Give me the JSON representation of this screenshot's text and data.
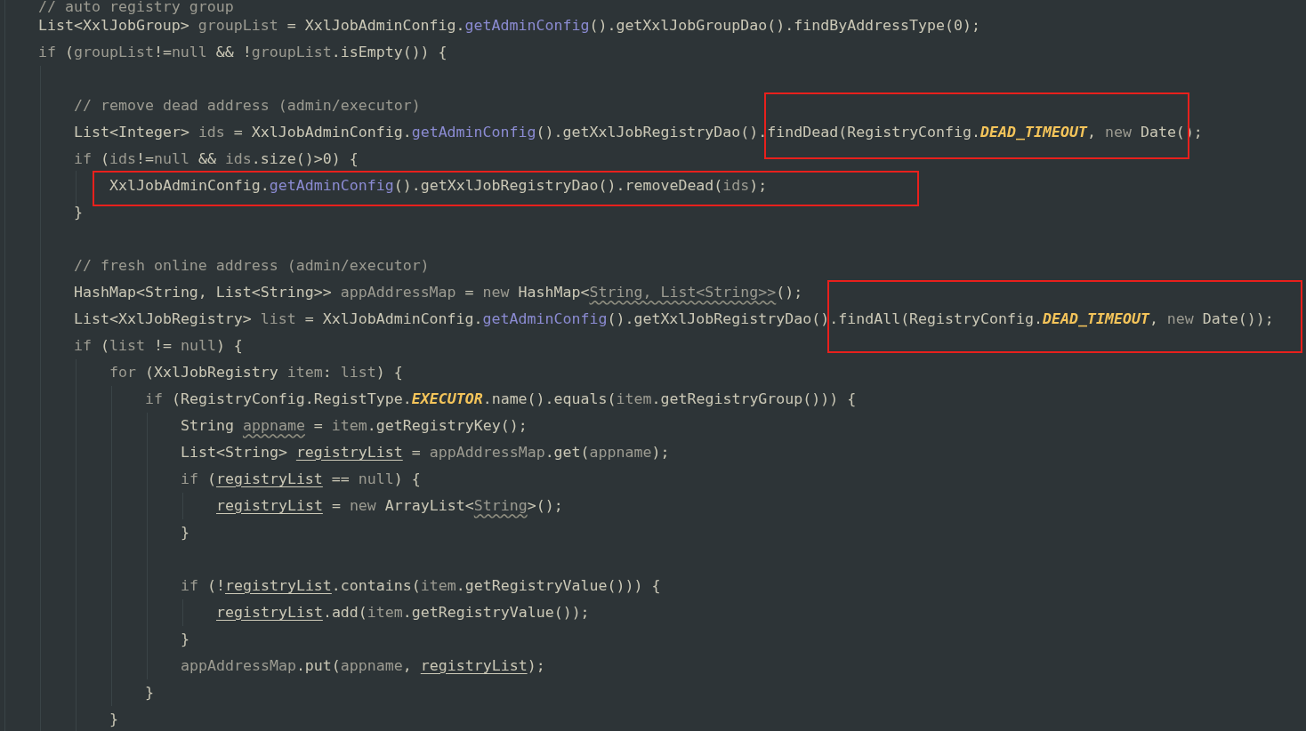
{
  "editor": {
    "lines": [
      {
        "kind": "code",
        "tokens": [
          {
            "text": "// auto registry group",
            "kind": "comment"
          }
        ]
      },
      {
        "kind": "code",
        "tokens": [
          {
            "text": "List<XxlJobGroup> ",
            "kind": "plain"
          },
          {
            "text": "groupList",
            "kind": "local"
          },
          {
            "text": " = XxlJobAdminConfig.",
            "kind": "plain"
          },
          {
            "text": "getAdminConfig",
            "kind": "static"
          },
          {
            "text": "().getXxlJobGroupDao().findByAddressType(0);",
            "kind": "plain"
          }
        ]
      },
      {
        "kind": "code",
        "tokens": [
          {
            "text": "if",
            "kind": "local"
          },
          {
            "text": " (",
            "kind": "plain"
          },
          {
            "text": "groupList",
            "kind": "local"
          },
          {
            "text": "!=",
            "kind": "plain"
          },
          {
            "text": "null",
            "kind": "local"
          },
          {
            "text": " && !",
            "kind": "plain"
          },
          {
            "text": "groupList",
            "kind": "local"
          },
          {
            "text": ".isEmpty()) {",
            "kind": "plain"
          }
        ],
        "children": [
          {
            "kind": "blank"
          },
          {
            "kind": "code",
            "tokens": [
              {
                "text": "// remove dead address (admin/executor)",
                "kind": "comment"
              }
            ]
          },
          {
            "kind": "code",
            "tokens": [
              {
                "text": "List<Integer> ",
                "kind": "plain"
              },
              {
                "text": "ids",
                "kind": "local"
              },
              {
                "text": " = XxlJobAdminConfig.",
                "kind": "plain"
              },
              {
                "text": "getAdminConfig",
                "kind": "static"
              },
              {
                "text": "().getXxlJobRegistryDao().",
                "kind": "plain"
              }
            ],
            "highlight": [
              {
                "text": "findDead(RegistryConfig.",
                "kind": "plain"
              },
              {
                "text": "DEAD_TIMEOUT",
                "kind": "constant"
              },
              {
                "text": ", ",
                "kind": "plain"
              },
              {
                "text": "new",
                "kind": "local"
              },
              {
                "text": " Date(",
                "kind": "plain"
              }
            ],
            "after": [
              {
                "text": ");",
                "kind": "plain"
              }
            ]
          },
          {
            "kind": "code",
            "tokens": [
              {
                "text": "if",
                "kind": "local"
              },
              {
                "text": " (",
                "kind": "plain"
              },
              {
                "text": "ids",
                "kind": "local"
              },
              {
                "text": "!=",
                "kind": "plain"
              },
              {
                "text": "null",
                "kind": "local"
              },
              {
                "text": " && ",
                "kind": "plain"
              },
              {
                "text": "ids",
                "kind": "local"
              },
              {
                "text": ".size()>0) {",
                "kind": "plain"
              }
            ],
            "children": [
              {
                "kind": "code",
                "highlight": [
                  {
                    "text": "XxlJobAdminConfig.",
                    "kind": "plain"
                  },
                  {
                    "text": "getAdminConfig",
                    "kind": "static"
                  },
                  {
                    "text": "().getXxlJobRegistryDao().removeDead(",
                    "kind": "plain"
                  },
                  {
                    "text": "ids",
                    "kind": "local"
                  },
                  {
                    "text": ");",
                    "kind": "plain"
                  }
                ]
              }
            ]
          },
          {
            "kind": "code",
            "tokens": [
              {
                "text": "}",
                "kind": "plain"
              }
            ]
          },
          {
            "kind": "blank"
          },
          {
            "kind": "code",
            "tokens": [
              {
                "text": "// fresh online address (admin/executor)",
                "kind": "comment"
              }
            ]
          },
          {
            "kind": "code",
            "tokens": [
              {
                "text": "HashMap<String, List<String>> ",
                "kind": "plain"
              },
              {
                "text": "appAddressMap",
                "kind": "local"
              },
              {
                "text": " = ",
                "kind": "plain"
              },
              {
                "text": "new",
                "kind": "local"
              },
              {
                "text": " HashMap<",
                "kind": "plain"
              },
              {
                "text": "String, List<String>>",
                "kind": "redundant"
              },
              {
                "text": "();",
                "kind": "plain"
              }
            ]
          },
          {
            "kind": "code",
            "tokens": [
              {
                "text": "List<XxlJobRegistry> ",
                "kind": "plain"
              },
              {
                "text": "list",
                "kind": "local"
              },
              {
                "text": " = XxlJobAdminConfig.",
                "kind": "plain"
              },
              {
                "text": "getAdminConfig",
                "kind": "static"
              },
              {
                "text": "().getXxlJobRegistryDao()",
                "kind": "plain"
              }
            ],
            "highlight": [
              {
                "text": ".findAll(RegistryConfig.",
                "kind": "plain"
              },
              {
                "text": "DEAD_TIMEOUT",
                "kind": "constant"
              },
              {
                "text": ", ",
                "kind": "plain"
              },
              {
                "text": "new",
                "kind": "local"
              },
              {
                "text": " Date());",
                "kind": "plain"
              }
            ]
          },
          {
            "kind": "code",
            "tokens": [
              {
                "text": "if",
                "kind": "local"
              },
              {
                "text": " (",
                "kind": "plain"
              },
              {
                "text": "list",
                "kind": "local"
              },
              {
                "text": " != ",
                "kind": "plain"
              },
              {
                "text": "null",
                "kind": "local"
              },
              {
                "text": ") {",
                "kind": "plain"
              }
            ],
            "children": [
              {
                "kind": "code",
                "tokens": [
                  {
                    "text": "for",
                    "kind": "local"
                  },
                  {
                    "text": " (XxlJobRegistry ",
                    "kind": "plain"
                  },
                  {
                    "text": "item",
                    "kind": "local"
                  },
                  {
                    "text": ": ",
                    "kind": "plain"
                  },
                  {
                    "text": "list",
                    "kind": "local"
                  },
                  {
                    "text": ") {",
                    "kind": "plain"
                  }
                ],
                "children": [
                  {
                    "kind": "code",
                    "tokens": [
                      {
                        "text": "if",
                        "kind": "local"
                      },
                      {
                        "text": " (RegistryConfig.RegistType.",
                        "kind": "plain"
                      },
                      {
                        "text": "EXECUTOR",
                        "kind": "constant"
                      },
                      {
                        "text": ".name().equals(",
                        "kind": "plain"
                      },
                      {
                        "text": "item",
                        "kind": "local"
                      },
                      {
                        "text": ".getRegistryGroup())) {",
                        "kind": "plain"
                      }
                    ],
                    "children": [
                      {
                        "kind": "code",
                        "tokens": [
                          {
                            "text": "String ",
                            "kind": "plain"
                          },
                          {
                            "text": "appname",
                            "kind": "redundant"
                          },
                          {
                            "text": " = ",
                            "kind": "plain"
                          },
                          {
                            "text": "item",
                            "kind": "local"
                          },
                          {
                            "text": ".getRegistryKey();",
                            "kind": "plain"
                          }
                        ]
                      },
                      {
                        "kind": "code",
                        "tokens": [
                          {
                            "text": "List<String> ",
                            "kind": "plain"
                          },
                          {
                            "text": "registryList",
                            "kind": "reassigned"
                          },
                          {
                            "text": " = ",
                            "kind": "plain"
                          },
                          {
                            "text": "appAddressMap",
                            "kind": "local"
                          },
                          {
                            "text": ".get(",
                            "kind": "plain"
                          },
                          {
                            "text": "appname",
                            "kind": "local"
                          },
                          {
                            "text": ");",
                            "kind": "plain"
                          }
                        ]
                      },
                      {
                        "kind": "code",
                        "tokens": [
                          {
                            "text": "if",
                            "kind": "local"
                          },
                          {
                            "text": " (",
                            "kind": "plain"
                          },
                          {
                            "text": "registryList",
                            "kind": "reassigned"
                          },
                          {
                            "text": " == ",
                            "kind": "plain"
                          },
                          {
                            "text": "null",
                            "kind": "local"
                          },
                          {
                            "text": ") {",
                            "kind": "plain"
                          }
                        ],
                        "children": [
                          {
                            "kind": "code",
                            "tokens": [
                              {
                                "text": "registryList",
                                "kind": "reassigned"
                              },
                              {
                                "text": " = ",
                                "kind": "plain"
                              },
                              {
                                "text": "new",
                                "kind": "local"
                              },
                              {
                                "text": " ArrayList<",
                                "kind": "plain"
                              },
                              {
                                "text": "String",
                                "kind": "redundant"
                              },
                              {
                                "text": ">();",
                                "kind": "plain"
                              }
                            ]
                          }
                        ]
                      },
                      {
                        "kind": "code",
                        "tokens": [
                          {
                            "text": "}",
                            "kind": "plain"
                          }
                        ]
                      },
                      {
                        "kind": "blank"
                      },
                      {
                        "kind": "code",
                        "tokens": [
                          {
                            "text": "if",
                            "kind": "local"
                          },
                          {
                            "text": " (!",
                            "kind": "plain"
                          },
                          {
                            "text": "registryList",
                            "kind": "reassigned"
                          },
                          {
                            "text": ".contains(",
                            "kind": "plain"
                          },
                          {
                            "text": "item",
                            "kind": "local"
                          },
                          {
                            "text": ".getRegistryValue())) {",
                            "kind": "plain"
                          }
                        ],
                        "children": [
                          {
                            "kind": "code",
                            "tokens": [
                              {
                                "text": "registryList",
                                "kind": "reassigned"
                              },
                              {
                                "text": ".add(",
                                "kind": "plain"
                              },
                              {
                                "text": "item",
                                "kind": "local"
                              },
                              {
                                "text": ".getRegistryValue());",
                                "kind": "plain"
                              }
                            ]
                          }
                        ]
                      },
                      {
                        "kind": "code",
                        "tokens": [
                          {
                            "text": "}",
                            "kind": "plain"
                          }
                        ]
                      },
                      {
                        "kind": "code",
                        "tokens": [
                          {
                            "text": "appAddressMap",
                            "kind": "local"
                          },
                          {
                            "text": ".put(",
                            "kind": "plain"
                          },
                          {
                            "text": "appname",
                            "kind": "local"
                          },
                          {
                            "text": ", ",
                            "kind": "plain"
                          },
                          {
                            "text": "registryList",
                            "kind": "reassigned"
                          },
                          {
                            "text": ");",
                            "kind": "plain"
                          }
                        ]
                      }
                    ]
                  },
                  {
                    "kind": "code",
                    "tokens": [
                      {
                        "text": "}",
                        "kind": "plain"
                      }
                    ]
                  }
                ]
              },
              {
                "kind": "code",
                "tokens": [
                  {
                    "text": "}",
                    "kind": "plain"
                  }
                ]
              }
            ]
          }
        ]
      }
    ]
  }
}
